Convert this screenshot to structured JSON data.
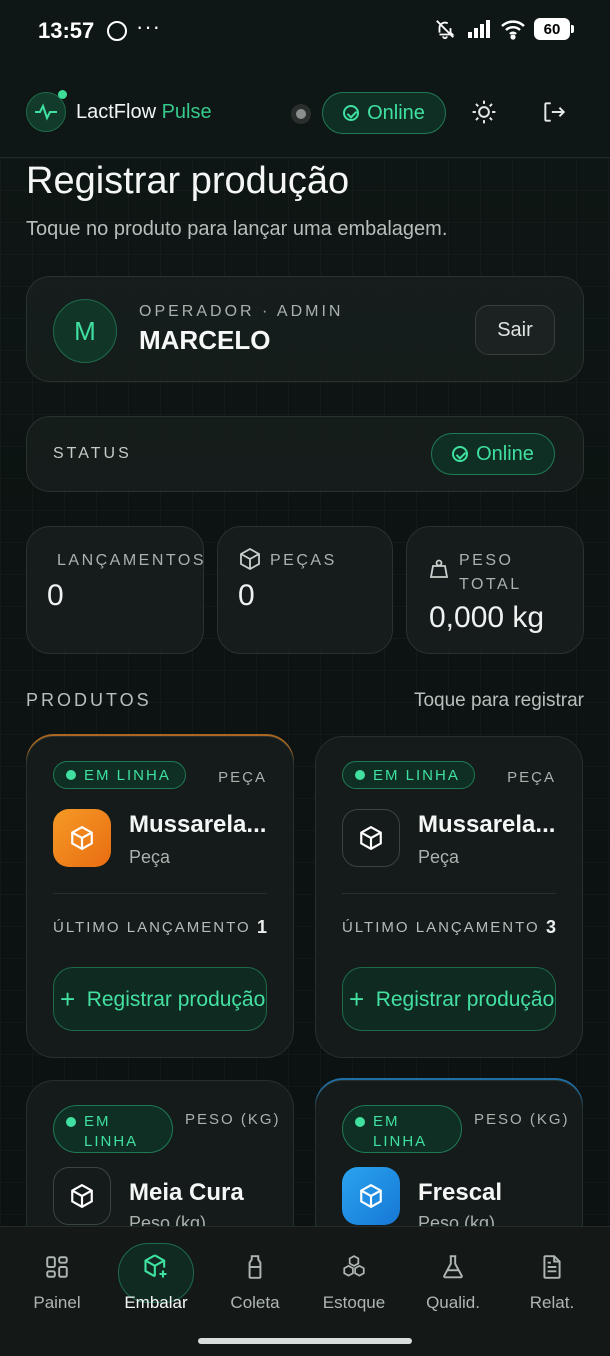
{
  "status_bar": {
    "time": "13:57",
    "dots": "···",
    "battery": "60"
  },
  "header": {
    "brand_main": "LactFlow",
    "brand_accent": "Pulse",
    "online_label": "Online",
    "accent_color": "#3fe0a0"
  },
  "page": {
    "title": "Registrar produção",
    "subtitle": "Toque no produto para lançar uma embalagem."
  },
  "operator": {
    "initial": "M",
    "role": "OPERADOR · ADMIN",
    "name": "MARCELO",
    "logout_label": "Sair"
  },
  "status": {
    "label": "STATUS",
    "value": "Online"
  },
  "stats": [
    {
      "label": "LANÇAMENTOS",
      "value": "0",
      "icon": "none"
    },
    {
      "label": "PEÇAS",
      "value": "0",
      "icon": "box-icon"
    },
    {
      "label": "PESO\nTOTAL",
      "value": "0,000 kg",
      "icon": "weight-icon"
    }
  ],
  "products_section": {
    "title": "PRODUTOS",
    "hint": "Toque para registrar"
  },
  "products": [
    {
      "badge": "EM LINHA",
      "unit": "PEÇA",
      "name": "Mussarela...",
      "type": "Peça",
      "last_label": "ÚLTIMO LANÇAMENTO",
      "last_value": "1",
      "button": "Registrar produção",
      "icon_color": "#f08a1e"
    },
    {
      "badge": "EM LINHA",
      "unit": "PEÇA",
      "name": "Mussarela...",
      "type": "Peça",
      "last_label": "ÚLTIMO LANÇAMENTO",
      "last_value": "3",
      "button": "Registrar produção",
      "icon_color": "#151b1a"
    },
    {
      "badge": "EM LINHA",
      "unit": "PESO (KG)",
      "name": "Meia Cura",
      "type": "Peso (kg)",
      "icon_color": "#151b1a"
    },
    {
      "badge": "EM LINHA",
      "unit": "PESO (KG)",
      "name": "Frescal",
      "type": "Peso (kg)",
      "icon_color": "#1f8fe2"
    }
  ],
  "nav": [
    {
      "label": "Painel",
      "icon": "grid-icon"
    },
    {
      "label": "Embalar",
      "icon": "package-plus-icon",
      "active": true
    },
    {
      "label": "Coleta",
      "icon": "milk-bottle-icon"
    },
    {
      "label": "Estoque",
      "icon": "boxes-icon"
    },
    {
      "label": "Qualid.",
      "icon": "flask-icon"
    },
    {
      "label": "Relat.",
      "icon": "report-icon"
    }
  ]
}
